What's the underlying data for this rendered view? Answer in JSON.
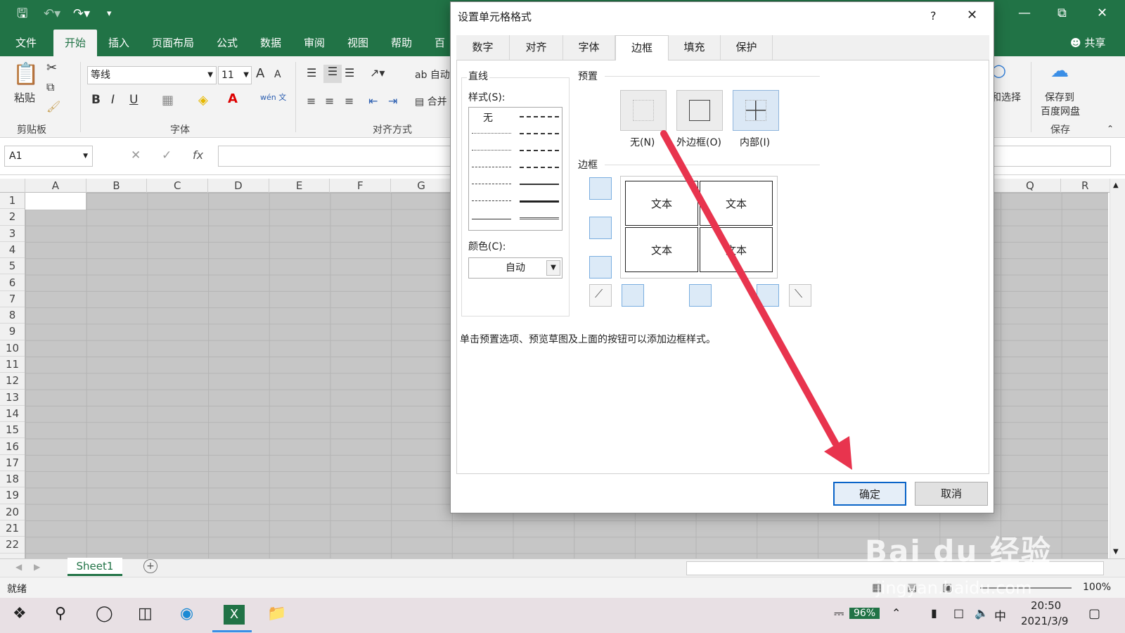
{
  "window": {
    "quick_access": [
      "save-icon",
      "undo-icon",
      "redo-icon",
      "customize-icon"
    ]
  },
  "ribbon_tabs": [
    "文件",
    "开始",
    "插入",
    "页面布局",
    "公式",
    "数据",
    "审阅",
    "视图",
    "帮助",
    "百"
  ],
  "share_label": "共享",
  "ribbon": {
    "paste_label": "粘贴",
    "clipboard_group": "剪贴板",
    "font_group": "字体",
    "align_group": "对齐方式",
    "font_name": "等线",
    "font_size": "11",
    "wrap_label": "自动",
    "merge_label": "合并",
    "select_label": "和选择",
    "save_baidu_label_1": "保存到",
    "save_baidu_label_2": "百度网盘",
    "save_group": "保存",
    "bold": "B",
    "italic": "I",
    "underline": "U",
    "grow": "A",
    "shrink": "A",
    "wen": "wén 文"
  },
  "formula_bar": {
    "name_box": "A1",
    "fx": "fx"
  },
  "columns": [
    "A",
    "B",
    "C",
    "D",
    "E",
    "F",
    "G",
    "Q",
    "R"
  ],
  "rows": [
    "1",
    "2",
    "3",
    "4",
    "5",
    "6",
    "7",
    "8",
    "9",
    "10",
    "11",
    "12",
    "13",
    "14",
    "15",
    "16",
    "17",
    "18",
    "19",
    "20",
    "21",
    "22"
  ],
  "sheet_tab": "Sheet1",
  "status": {
    "ready": "就绪",
    "zoom": "100%"
  },
  "taskbar": {
    "battery": "96%",
    "ime": "中",
    "time": "20:50",
    "date": "2021/3/9"
  },
  "dialog": {
    "title": "设置单元格格式",
    "help": "?",
    "tabs": [
      "数字",
      "对齐",
      "字体",
      "边框",
      "填充",
      "保护"
    ],
    "active_tab": "边框",
    "line_section": "直线",
    "style_label": "样式(S):",
    "none_style": "无",
    "color_label": "颜色(C):",
    "color_value": "自动",
    "presets_section": "预置",
    "preset_none": "无(N)",
    "preset_outline": "外边框(O)",
    "preset_inside": "内部(I)",
    "border_section": "边框",
    "preview_text": "文本",
    "hint": "单击预置选项、预览草图及上面的按钮可以添加边框样式。",
    "ok": "确定",
    "cancel": "取消"
  },
  "watermark": {
    "line1": "Bai du 经验",
    "line2": "jingyan.baidu.com"
  },
  "colors": {
    "excel_green": "#217346",
    "arrow_red": "#e8344e",
    "primary_border": "#0a64c8"
  }
}
